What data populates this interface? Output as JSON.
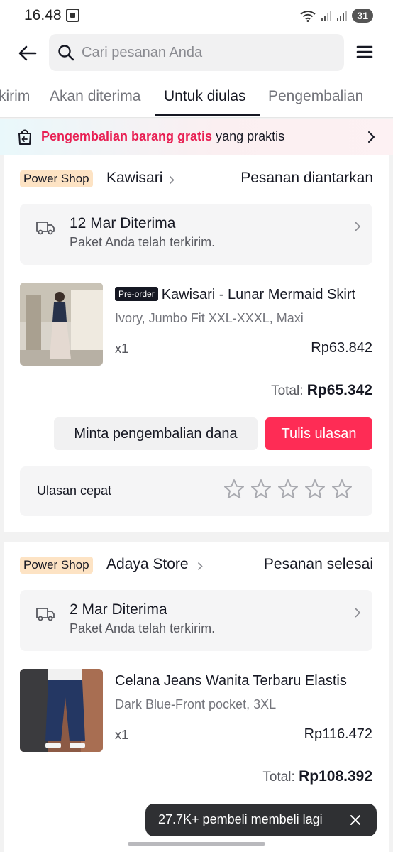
{
  "status_bar": {
    "time": "16.48",
    "battery": "31"
  },
  "header": {
    "back_icon": "arrow-left-icon",
    "search": {
      "placeholder": "Cari pesanan Anda",
      "value": ""
    },
    "menu_icon": "hamburger-menu-icon"
  },
  "tabs": [
    {
      "label": "Dikirim",
      "visible_text": "kirim",
      "active": false
    },
    {
      "label": "Akan diterima",
      "active": false
    },
    {
      "label": "Untuk diulas",
      "active": true
    },
    {
      "label": "Pengembalian",
      "active": false
    }
  ],
  "banner": {
    "highlight": "Pengembalian barang gratis",
    "text": " yang praktis"
  },
  "orders": [
    {
      "badge": "Power Shop",
      "shop": "Kawisari",
      "status": "Pesanan diantarkan",
      "delivery": {
        "title": "12 Mar Diterima",
        "subtitle": "Paket Anda telah terkirim."
      },
      "product": {
        "tag": "Pre-order",
        "title": "Kawisari - Lunar Mermaid Skirt",
        "variant": "Ivory, Jumbo Fit XXL-XXXL, Maxi",
        "qty": "x1",
        "price": "Rp63.842"
      },
      "total_label": "Total:",
      "total_value": "Rp65.342",
      "actions": {
        "refund": "Minta pengembalian dana",
        "review": "Tulis ulasan"
      },
      "quick_review": {
        "label": "Ulasan cepat",
        "stars": 5
      }
    },
    {
      "badge": "Power Shop",
      "shop": "Adaya Store",
      "status": "Pesanan selesai",
      "delivery": {
        "title": "2 Mar Diterima",
        "subtitle": "Paket Anda telah terkirim."
      },
      "product": {
        "title": "Celana Jeans Wanita Terbaru Elastis",
        "variant": "Dark Blue-Front pocket, 3XL",
        "qty": "x1",
        "price": "Rp116.472"
      },
      "total_label": "Total:",
      "total_value": "Rp108.392"
    }
  ],
  "toast": {
    "text": "27.7K+ pembeli membeli lagi"
  },
  "colors": {
    "accent": "#fe2c55",
    "badge_bg": "#fde3c4",
    "banner_highlight": "#e81e52",
    "toast_bg": "#2f3033"
  }
}
